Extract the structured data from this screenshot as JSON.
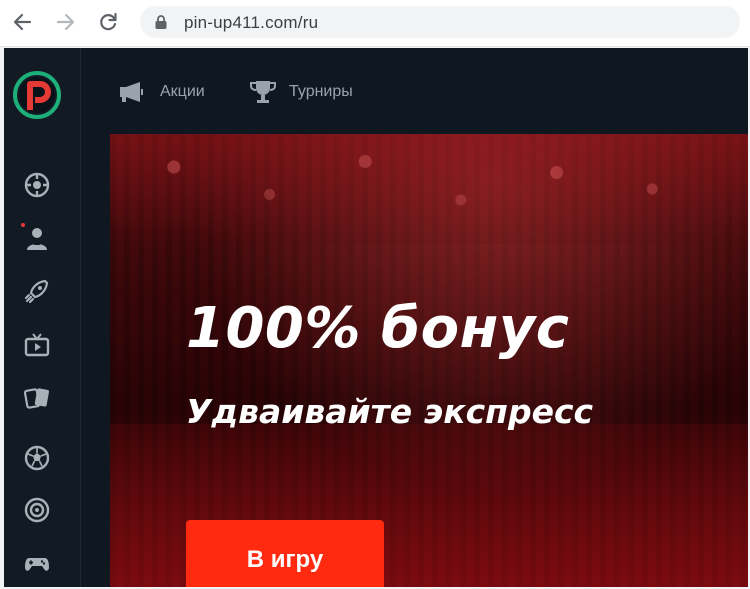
{
  "browser": {
    "url": "pin-up411.com/ru",
    "icons": [
      "back-arrow-icon",
      "forward-arrow-icon",
      "reload-icon",
      "lock-icon"
    ]
  },
  "topnav": {
    "items": [
      {
        "label": "Акции",
        "icon": "megaphone-icon"
      },
      {
        "label": "Турниры",
        "icon": "trophy-icon"
      }
    ]
  },
  "sidebar": {
    "icons": [
      "sports-icon",
      "live-dealer-icon",
      "rocket-icon",
      "tv-icon",
      "cards-icon",
      "football-icon",
      "target-icon",
      "gamepad-icon"
    ]
  },
  "banner": {
    "headline": "100% бонус",
    "subline": "Удваивайте экспресс",
    "cta_label": "В игру"
  },
  "colors": {
    "app_bg": "#0f1721",
    "cta": "#ff2a10",
    "logo_ring": "#1db07a",
    "logo_p": "#e53935"
  }
}
